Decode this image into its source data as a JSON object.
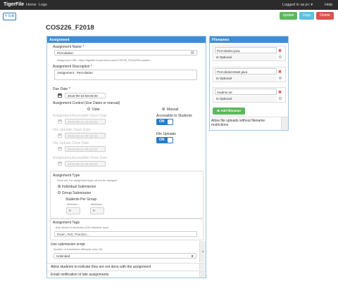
{
  "nav": {
    "brand": "TigerFile",
    "home": "Home",
    "logs": "Logs",
    "user": "Logged in as jrc",
    "user_caret": "▾",
    "help": "Help"
  },
  "toolbar": {
    "edit": "Edit",
    "edit_icon": "edit-icon",
    "update": "Update",
    "copy": "Copy",
    "delete": "Delete"
  },
  "page": {
    "title": "COS226_F2018"
  },
  "assignment": {
    "header": "Assignment",
    "name_label": "Assignment Name *",
    "name_value": "Percolation",
    "url_text": "Assignment URL: https://tigerfile.cs.princeton.edu/COS226_F2018/Percolation",
    "desc_label": "Assignment Description *",
    "desc_value": "Assignment : Percolation",
    "due_label": "Due Date *",
    "due_value": "2018-09-18 00:00:00",
    "control_label": "Assignment Control (Use Dates or manual)",
    "opt_date": "Date",
    "opt_manual": "Manual",
    "open_label": "Assignment Accessible Open Date",
    "open_value": "2018-09-11 09:15:00",
    "accessible_label": "Accessible to Students",
    "toggle_on": "ON",
    "file_open_label": "File Uploads Open Date",
    "file_open_value": "2018-09-11 09:15:00",
    "file_uploads_label": "File Uploads",
    "file_close_label": "File Upload Close Date",
    "file_close_value": "2018-09-11 09:15:00",
    "close_label": "Assignment Accessible Close Date",
    "close_value": "2018-09-11 09:15:00",
    "type_label": "Assignment Type",
    "type_note": "Once set, the assignment type cannot be changed.",
    "type_individual": "Individual Submission",
    "type_group": "Group Submission",
    "spg_label": "Students Per Group",
    "min_label": "Minimum",
    "max_label": "Maximum",
    "min_value": "0",
    "max_value": "0",
    "tags_label": "Assignment Tags",
    "tags_note": "(Not shown to students) (100 character max)",
    "tags_placeholder": "Exam, Test, Practice...",
    "script_label": "Use submission script",
    "attempts_note": "Number of submission attempts (max 15)",
    "attempts_value": "Unlimited",
    "not_done_label": "Allow students to indicate they are not done with the assignment",
    "late_label": "Email notification of late assignments"
  },
  "filenames": {
    "header": "Filenames",
    "files": [
      {
        "name": "Percolation.java",
        "optional": "Is Optional"
      },
      {
        "name": "PercolationStats.java",
        "optional": "Is Optional"
      },
      {
        "name": "readme.txt",
        "optional": "Is Optional"
      }
    ],
    "remove_glyph": "✖",
    "add_label": "Add filename",
    "add_icon": "plus-circle-icon",
    "allow_note": "Allow file uploads without filename restrictions"
  },
  "colors": {
    "navbar": "#2b2b2b",
    "panel_header": "#3c8dd6",
    "update": "#5cb85c",
    "copy": "#5bc0de",
    "delete": "#d9534f",
    "toggle": "#2a7bc6"
  }
}
